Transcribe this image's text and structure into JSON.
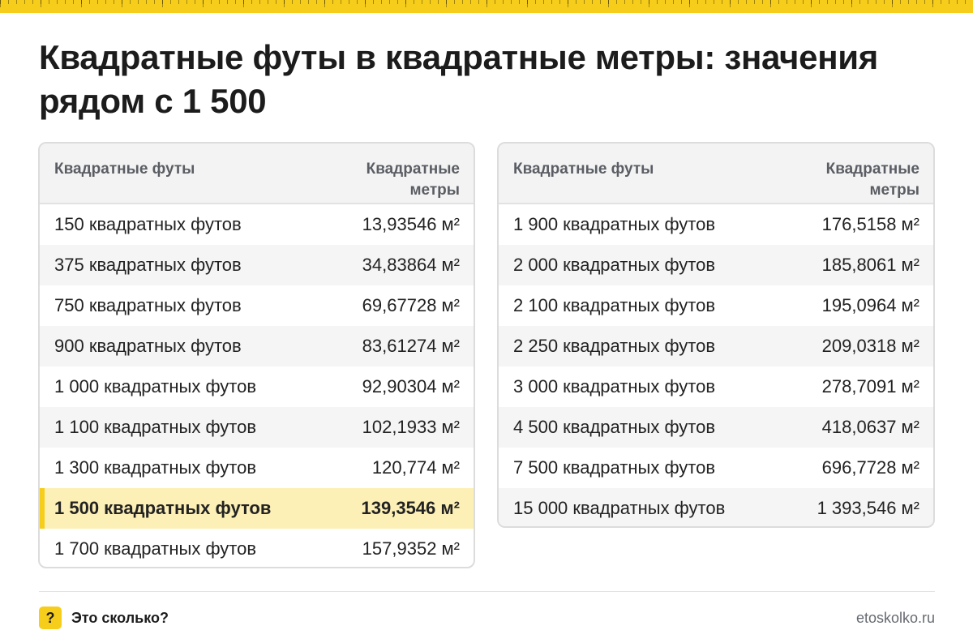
{
  "title": "Квадратные футы в квадратные метры: значения рядом с 1 500",
  "columns": {
    "feet": "Квадратные футы",
    "meters": "Квадратные метры"
  },
  "left_rows": [
    {
      "feet": "150 квадратных футов",
      "meters": "13,93546 м²"
    },
    {
      "feet": "375 квадратных футов",
      "meters": "34,83864 м²"
    },
    {
      "feet": "750 квадратных футов",
      "meters": "69,67728 м²"
    },
    {
      "feet": "900 квадратных футов",
      "meters": "83,61274 м²"
    },
    {
      "feet": "1 000 квадратных футов",
      "meters": "92,90304 м²"
    },
    {
      "feet": "1 100 квадратных футов",
      "meters": "102,1933 м²"
    },
    {
      "feet": "1 300 квадратных футов",
      "meters": "120,774 м²"
    },
    {
      "feet": "1 500 квадратных футов",
      "meters": "139,3546 м²"
    },
    {
      "feet": "1 700 квадратных футов",
      "meters": "157,9352 м²"
    }
  ],
  "right_rows": [
    {
      "feet": "1 900 квадратных футов",
      "meters": "176,5158 м²"
    },
    {
      "feet": "2 000 квадратных футов",
      "meters": "185,8061 м²"
    },
    {
      "feet": "2 100 квадратных футов",
      "meters": "195,0964 м²"
    },
    {
      "feet": "2 250 квадратных футов",
      "meters": "209,0318 м²"
    },
    {
      "feet": "3 000 квадратных футов",
      "meters": "278,7091 м²"
    },
    {
      "feet": "4 500 квадратных футов",
      "meters": "418,0637 м²"
    },
    {
      "feet": "7 500 квадратных футов",
      "meters": "696,7728 м²"
    },
    {
      "feet": "15 000 квадратных футов",
      "meters": "1 393,546 м²"
    }
  ],
  "footer": {
    "badge": "?",
    "brand": "Это сколько?",
    "site": "etoskolko.ru"
  },
  "colors": {
    "accent": "#f7cd1c",
    "highlight_row": "#fdf0b6"
  }
}
